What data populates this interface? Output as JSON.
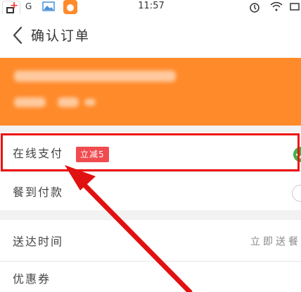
{
  "status_bar": {
    "network": "G",
    "time": "11:57"
  },
  "header": {
    "title": "确认订单"
  },
  "payment": {
    "online": {
      "label": "在线支付",
      "promo": "立减5",
      "selected": true
    },
    "cod": {
      "label": "餐到付款",
      "selected": false
    }
  },
  "delivery": {
    "time_label": "送达时间",
    "time_value": "立即送餐",
    "coupon_label": "优惠券"
  },
  "colors": {
    "banner": "#ff8a2a",
    "promo_tag": "#f04b50",
    "check": "#3cb34a",
    "annotation_red": "#e11111"
  },
  "icons": [
    "back-icon",
    "check-icon",
    "alarm-icon",
    "wifi-icon",
    "image-icon",
    "app-icon"
  ]
}
